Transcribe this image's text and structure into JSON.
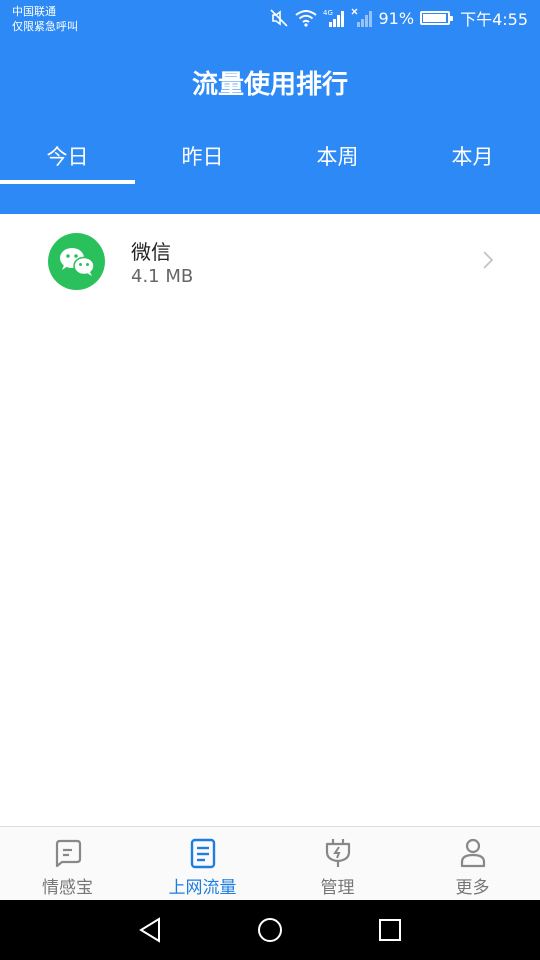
{
  "status_bar": {
    "carrier_line1": "中国联通",
    "carrier_line2": "仅限紧急呼叫",
    "battery_percent": "91%",
    "time": "下午4:55",
    "network_type": "4G"
  },
  "header": {
    "title": "流量使用排行",
    "background_color": "#2d89f5"
  },
  "tabs": [
    {
      "label": "今日",
      "active": true
    },
    {
      "label": "昨日",
      "active": false
    },
    {
      "label": "本周",
      "active": false
    },
    {
      "label": "本月",
      "active": false
    }
  ],
  "usage_list": [
    {
      "app_name": "微信",
      "usage": "4.1 MB",
      "icon": "wechat-icon",
      "icon_color": "#2ac05c"
    }
  ],
  "bottom_nav": [
    {
      "label": "情感宝",
      "icon": "chat-bubble-icon",
      "active": false
    },
    {
      "label": "上网流量",
      "icon": "document-icon",
      "active": true
    },
    {
      "label": "管理",
      "icon": "plug-icon",
      "active": false
    },
    {
      "label": "更多",
      "icon": "person-icon",
      "active": false
    }
  ],
  "accent_color": "#1f7de0"
}
